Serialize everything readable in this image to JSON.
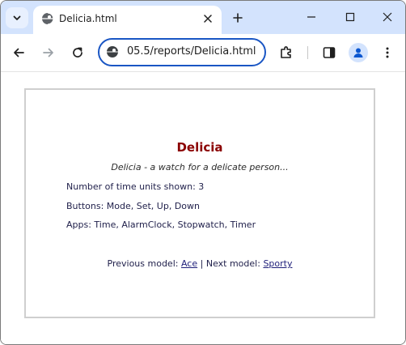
{
  "browser": {
    "tab": {
      "title": "Delicia.html"
    },
    "address_bar": {
      "url": "05.5/reports/Delicia.html"
    }
  },
  "page": {
    "heading": "Delicia",
    "subtitle": "Delicia - a watch for a delicate person...",
    "details": [
      "Number of time units shown: 3",
      "Buttons: Mode, Set, Up, Down",
      "Apps: Time, AlarmClock, Stopwatch, Timer"
    ],
    "navigation": {
      "prev_label": "Previous model:",
      "prev_link": "Ace",
      "separator": "|",
      "next_label": "Next model:",
      "next_link": "Sporty"
    }
  },
  "colors": {
    "tabstrip": "#d3e3fd",
    "omnibox_border": "#1a56c4",
    "heading": "#8b0000"
  },
  "icons": [
    "chevron-down-icon",
    "globe-icon",
    "close-icon",
    "plus-icon",
    "minimize-icon",
    "maximize-icon",
    "close-window-icon",
    "back-arrow-icon",
    "forward-arrow-icon",
    "reload-icon",
    "extensions-icon",
    "side-panel-icon",
    "profile-icon",
    "more-menu-icon"
  ]
}
